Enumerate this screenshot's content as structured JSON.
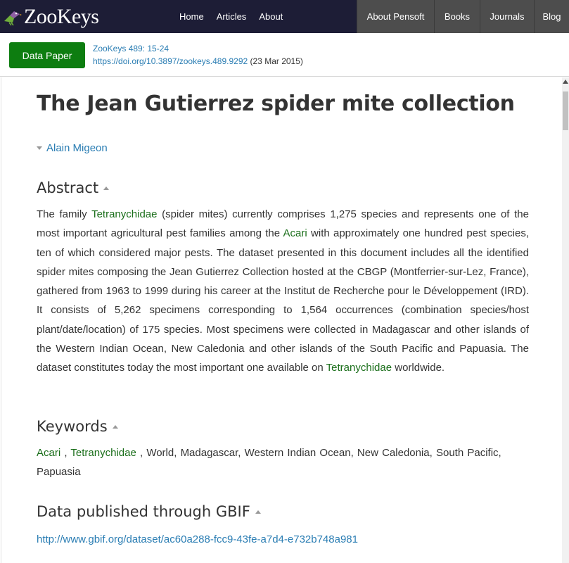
{
  "nav": {
    "logo_text": "ZooKeys",
    "main_links": [
      "Home",
      "Articles",
      "About"
    ],
    "pensoft_links": [
      "About Pensoft",
      "Books",
      "Journals",
      "Blog"
    ]
  },
  "article": {
    "type_label": "Data Paper",
    "citation": "ZooKeys 489: 15-24",
    "doi": "https://doi.org/10.3897/zookeys.489.9292",
    "date": "(23 Mar 2015)",
    "title": "The Jean Gutierrez spider mite collection",
    "author": "Alain Migeon"
  },
  "abstract": {
    "heading": "Abstract",
    "p1": "The family ",
    "t1": "Tetranychidae",
    "p2": " (spider mites) currently comprises 1,275 species and represents one of the most important agricultural pest families among the ",
    "t2": "Acari",
    "p3": " with approximately one hundred pest species, ten of which considered major pests. The dataset presented in this document includes all the identified spider mites composing the Jean Gutierrez Collection hosted at the CBGP (Montferrier-sur-Lez, France), gathered from 1963 to 1999 during his career at the Institut de Recherche pour le Développement (IRD). It consists of 5,262 specimens corresponding to 1,564 occurrences (combination species/host plant/date/location) of 175 species. Most specimens were collected in Madagascar and other islands of the Western Indian Ocean, New Caledonia and other islands of the South Pacific and Papuasia. The dataset constitutes today the most important one available on ",
    "t3": "Tetranychidae",
    "p4": " worldwide."
  },
  "keywords": {
    "heading": "Keywords",
    "k1": "Acari",
    "sep1": " , ",
    "k2": "Tetranychidae",
    "rest": " , World, Madagascar, Western Indian Ocean, New Caledonia, South Pacific, Papuasia"
  },
  "gbif": {
    "heading": "Data published through GBIF",
    "url": "http://www.gbif.org/dataset/ac60a288-fcc9-43fe-a7d4-e732b748a981"
  },
  "colors": {
    "nav_bg": "#1d1d36",
    "pensoft_bg": "#4d4d4d",
    "data_paper_green": "#0d7d10",
    "link_blue": "#2a7db3",
    "taxon_green": "#1a6e1a"
  }
}
